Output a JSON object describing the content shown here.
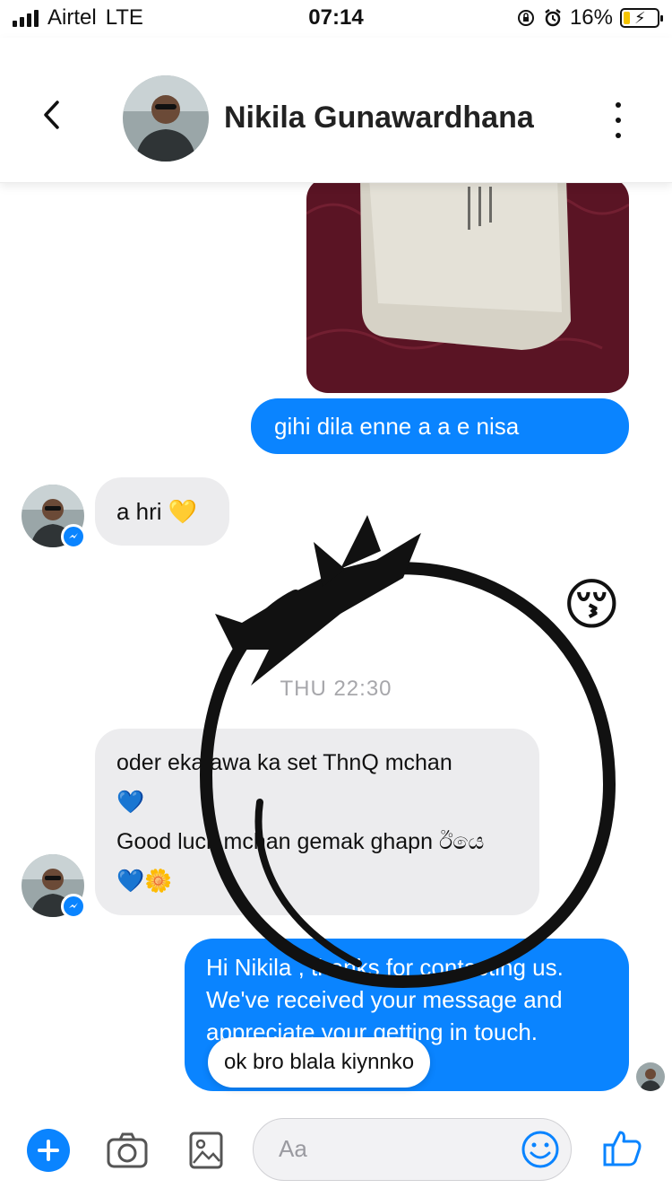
{
  "status_bar": {
    "carrier": "Airtel",
    "network": "LTE",
    "time": "07:14",
    "battery": "16%"
  },
  "header": {
    "contact_name": "Nikila Gunawardhana"
  },
  "messages": {
    "sent_1": "gihi dila enne a a e nisa",
    "received_1": "a hri 💛",
    "emoji_sent": "😚",
    "timestamp": "THU 22:30",
    "received_2_line1": "oder eka awa ka set ThnQ mchan",
    "received_2_line2": "💙",
    "received_2_line3": "Good luck mchan gemak ghapn ඊයෙ",
    "received_2_line4": "💙🌼",
    "sent_2": "Hi Nikila , thanks for contacting us. We've received your message and appreciate your getting in touch.",
    "reply_pill": "ok bro blala kiynnko"
  },
  "input": {
    "placeholder": "Aa"
  },
  "colors": {
    "accent": "#0a84ff",
    "incoming_bubble": "#ececee"
  }
}
